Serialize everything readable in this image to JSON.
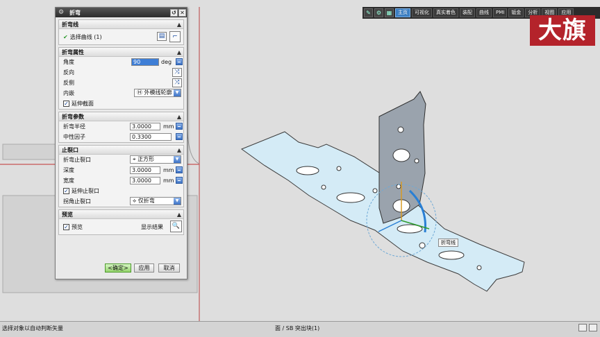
{
  "dialog": {
    "title": "折弯",
    "groups": {
      "bend_line": {
        "title": "折弯线",
        "select_curve": "选择曲线 (1)"
      },
      "bend_props": {
        "title": "折弯属性",
        "angle_label": "角度",
        "angle_value": "90",
        "angle_unit": "deg",
        "reverse_label": "反向",
        "reverse_side_label": "反侧",
        "inset_label": "内嵌",
        "inset_value": "外模线轮廓",
        "extend_section_label": "延伸截面"
      },
      "bend_params": {
        "title": "折弯参数",
        "radius_label": "折弯半径",
        "radius_value": "3.0000",
        "radius_unit": "mm",
        "neutral_label": "中性因子",
        "neutral_value": "0.3300"
      },
      "relief": {
        "title": "止裂口",
        "bend_relief_label": "折弯止裂口",
        "bend_relief_value": "正方形",
        "depth_label": "深度",
        "depth_value": "3.0000",
        "depth_unit": "mm",
        "width_label": "宽度",
        "width_value": "3.0000",
        "width_unit": "mm",
        "extend_relief_label": "延伸止裂口",
        "corner_relief_label": "拐角止裂口",
        "corner_relief_value": "仅折弯"
      },
      "preview": {
        "title": "预览",
        "preview_label": "预览",
        "show_result_label": "显示结果"
      }
    },
    "buttons": {
      "ok": "<确定>",
      "apply": "应用",
      "cancel": "取消"
    }
  },
  "toolbar": {
    "tabs": [
      "主页",
      "可视化",
      "真实着色",
      "装配",
      "曲线",
      "PMI",
      "钣金",
      "分析",
      "视图",
      "应用"
    ]
  },
  "logo_text": "大旗",
  "viewport": {
    "bend_line_tag": "折弯线"
  },
  "status": {
    "left": "选择对象以自动判断矢量",
    "middle": "面 / SB 突出块(1)"
  },
  "colors": {
    "check_green": "#2e9b2e",
    "accent_blue": "#3d7fc2",
    "logo_red": "#b4232b",
    "part_face": "#cfe6f2"
  }
}
